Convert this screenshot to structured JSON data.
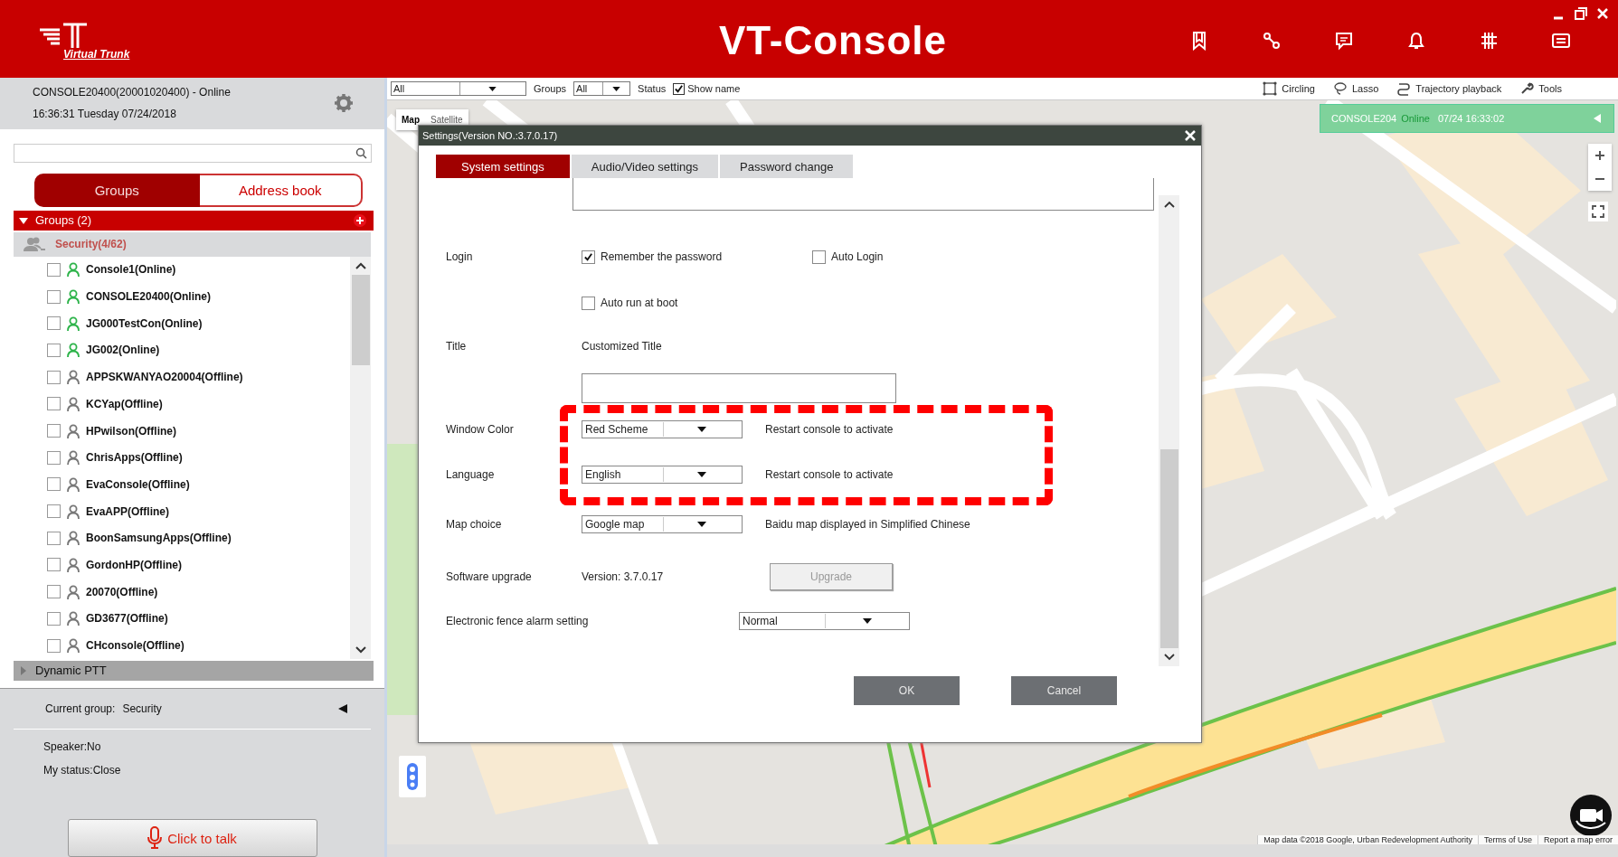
{
  "app": {
    "logo_text": "Virtual Trunk",
    "title": "VT-Console"
  },
  "session": {
    "console": "CONSOLE20400(20001020400) - Online",
    "datetime": "16:36:31 Tuesday 07/24/2018"
  },
  "sidebar_tabs": [
    {
      "label": "Groups",
      "selected": true
    },
    {
      "label": "Address book",
      "selected": false
    }
  ],
  "sections": [
    {
      "label": "Groups (2)",
      "expanded": true,
      "groups": [
        {
          "name": "Security(4/62)",
          "members": [
            {
              "name": "Console1(Online)",
              "online": true,
              "checked": false
            },
            {
              "name": "CONSOLE20400(Online)",
              "online": true,
              "checked": false
            },
            {
              "name": "JG000TestCon(Online)",
              "online": true,
              "checked": false
            },
            {
              "name": "JG002(Online)",
              "online": true,
              "checked": false
            },
            {
              "name": "APPSKWANYAO20004(Offline)",
              "online": false,
              "checked": false
            },
            {
              "name": "KCYap(Offline)",
              "online": false,
              "checked": false
            },
            {
              "name": "HPwilson(Offline)",
              "online": false,
              "checked": false
            },
            {
              "name": "ChrisApps(Offline)",
              "online": false,
              "checked": false
            },
            {
              "name": "EvaConsole(Offline)",
              "online": false,
              "checked": false
            },
            {
              "name": "EvaAPP(Offline)",
              "online": false,
              "checked": false
            },
            {
              "name": "BoonSamsungApps(Offline)",
              "online": false,
              "checked": false
            },
            {
              "name": "GordonHP(Offline)",
              "online": false,
              "checked": false
            },
            {
              "name": "20070(Offline)",
              "online": false,
              "checked": false
            },
            {
              "name": "GD3677(Offline)",
              "online": false,
              "checked": false
            },
            {
              "name": "CHconsole(Offline)",
              "online": false,
              "checked": false
            }
          ]
        }
      ]
    },
    {
      "label": "Dynamic PTT",
      "expanded": false
    }
  ],
  "status": {
    "current_group_label": "Current group:",
    "current_group": "Security",
    "speaker": "Speaker:No",
    "my_status": "My status:Close"
  },
  "talk_button": "Click to talk",
  "map_toolbar": {
    "group_filter": "All",
    "groups_label": "Groups",
    "status_filter": "All",
    "status_label": "Status",
    "show_name": {
      "label": "Show name",
      "checked": true
    },
    "tools": [
      {
        "label": "Circling",
        "kind": "circling"
      },
      {
        "label": "Lasso",
        "kind": "lasso"
      },
      {
        "label": "Trajectory playback",
        "kind": "trajectory"
      },
      {
        "label": "Tools",
        "kind": "tools"
      }
    ]
  },
  "map": {
    "map_types": [
      {
        "label": "Map",
        "selected": true
      },
      {
        "label": "Satellite",
        "selected": false
      }
    ],
    "notice": {
      "device": "CONSOLE204",
      "status": "Online",
      "time": "07/24 16:33:02"
    },
    "attribution": [
      "Map data ©2018 Google, Urban Redevelopment Authority",
      "Terms of Use",
      "Report a map error"
    ]
  },
  "dialog": {
    "title": "Settings(Version NO.:3.7.0.17)",
    "tabs": [
      {
        "label": "System settings",
        "selected": true
      },
      {
        "label": "Audio/Video settings",
        "selected": false
      },
      {
        "label": "Password change",
        "selected": false
      }
    ],
    "login": {
      "label": "Login",
      "options": [
        {
          "label": "Remember the password",
          "checked": true
        },
        {
          "label": "Auto Login",
          "checked": false
        },
        {
          "label": "Auto run at boot",
          "checked": false
        }
      ]
    },
    "title_setting": {
      "label": "Title",
      "caption": "Customized Title"
    },
    "selects": [
      {
        "label": "Window Color",
        "value": "Red Scheme",
        "note": "Restart console to activate"
      },
      {
        "label": "Language",
        "value": "English",
        "note": "Restart console to activate"
      },
      {
        "label": "Map choice",
        "value": "Google map",
        "note": "Baidu map displayed in Simplified Chinese"
      }
    ],
    "upgrade": {
      "label": "Software upgrade",
      "version": "Version: 3.7.0.17",
      "button": "Upgrade",
      "disabled": true
    },
    "fence": {
      "label": "Electronic fence alarm setting",
      "value": "Normal"
    },
    "buttons": [
      "OK",
      "Cancel"
    ]
  }
}
